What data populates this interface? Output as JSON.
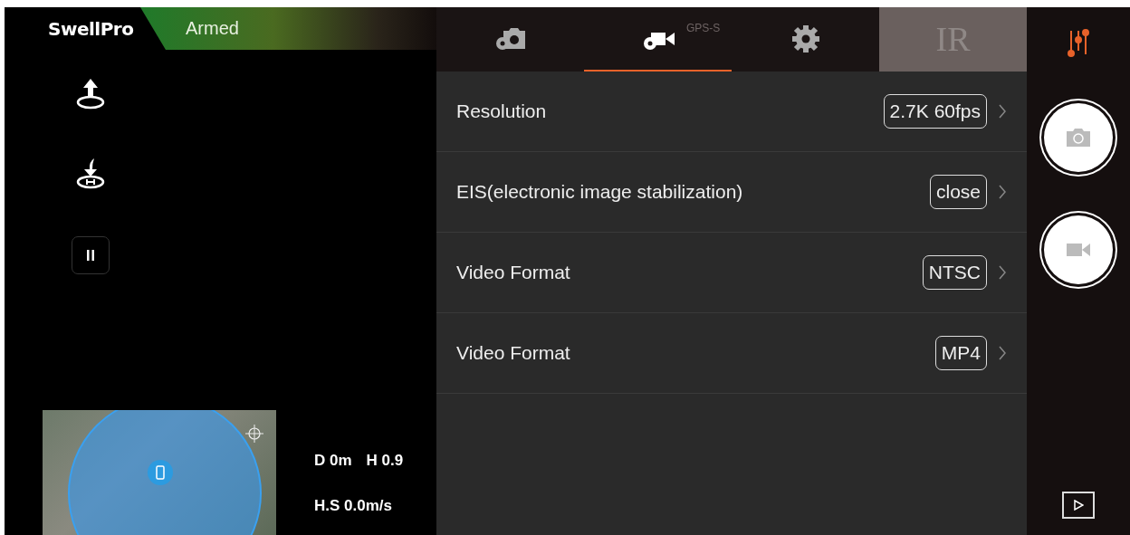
{
  "header": {
    "logo": "SwellPro",
    "status": "Armed"
  },
  "tabs": [
    {
      "kind": "photo",
      "selected": false
    },
    {
      "kind": "video",
      "selected": true
    },
    {
      "kind": "gear",
      "selected": false
    },
    {
      "kind": "text",
      "label": "IR",
      "selected": false
    }
  ],
  "background_status": {
    "gps": "GPS-S"
  },
  "settings": [
    {
      "label": "Resolution",
      "value": "2.7K 60fps"
    },
    {
      "label": "EIS(electronic image stabilization)",
      "value": "close"
    },
    {
      "label": "Video Format",
      "value": "NTSC"
    },
    {
      "label": "Video Format",
      "value": "MP4"
    }
  ],
  "telemetry": [
    [
      "D 0m",
      "H 0.9"
    ],
    [
      "H.S 0.0m/s"
    ]
  ]
}
